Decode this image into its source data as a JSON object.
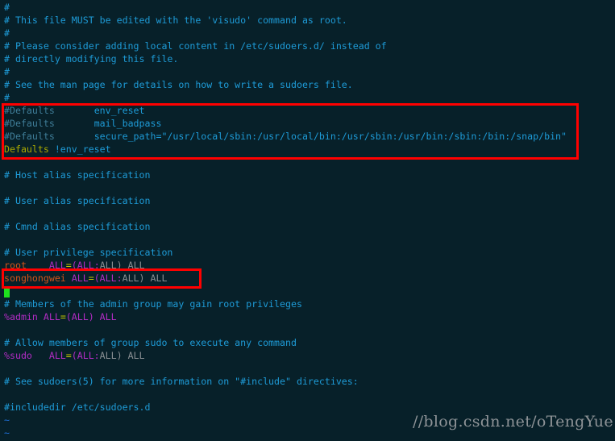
{
  "editor": {
    "colors": {
      "background": "#072029",
      "comment": "#1e9bd7",
      "highlight_box": "#ff0000",
      "cursor": "#1ee01e"
    },
    "lines": [
      [
        {
          "t": "#",
          "c": "comment"
        }
      ],
      [
        {
          "t": "# This file MUST be edited with the 'visudo' command as root.",
          "c": "comment"
        }
      ],
      [
        {
          "t": "#",
          "c": "comment"
        }
      ],
      [
        {
          "t": "# Please consider adding local content in /etc/sudoers.d/ instead of",
          "c": "comment"
        }
      ],
      [
        {
          "t": "# directly modifying this file.",
          "c": "comment"
        }
      ],
      [
        {
          "t": "#",
          "c": "comment"
        }
      ],
      [
        {
          "t": "# See the man page for details on how to write a sudoers file.",
          "c": "comment"
        }
      ],
      [
        {
          "t": "#",
          "c": "comment"
        }
      ],
      [
        {
          "t": "#Defaults       ",
          "c": "dcomment"
        },
        {
          "t": "env_reset",
          "c": "comment"
        }
      ],
      [
        {
          "t": "#Defaults       ",
          "c": "dcomment"
        },
        {
          "t": "mail_badpass",
          "c": "comment"
        }
      ],
      [
        {
          "t": "#Defaults       ",
          "c": "dcomment"
        },
        {
          "t": "secure_path=\"/usr/local/sbin:/usr/local/bin:/usr/sbin:/usr/bin:/sbin:/bin:/snap/bin\"",
          "c": "comment"
        }
      ],
      [
        {
          "t": "Defaults",
          "c": "yellow"
        },
        {
          "t": " !env_reset",
          "c": "comment"
        }
      ],
      [],
      [
        {
          "t": "# Host alias specification",
          "c": "comment"
        }
      ],
      [],
      [
        {
          "t": "# User alias specification",
          "c": "comment"
        }
      ],
      [],
      [
        {
          "t": "# Cmnd alias specification",
          "c": "comment"
        }
      ],
      [],
      [
        {
          "t": "# User privilege specification",
          "c": "comment"
        }
      ],
      [
        {
          "t": "root",
          "c": "user"
        },
        {
          "t": "    ALL",
          "c": "kw"
        },
        {
          "t": "=",
          "c": "eq"
        },
        {
          "t": "(ALL:",
          "c": "kw"
        },
        {
          "t": "ALL) ALL",
          "c": "plain"
        }
      ],
      [
        {
          "t": "songhongwei",
          "c": "user"
        },
        {
          "t": " ALL",
          "c": "kw"
        },
        {
          "t": "=",
          "c": "eq"
        },
        {
          "t": "(ALL:",
          "c": "kw"
        },
        {
          "t": "ALL) ALL",
          "c": "plain"
        }
      ],
      [
        {
          "t": "",
          "c": "cursor"
        }
      ],
      [
        {
          "t": "# Members of the admin group may gain root privileges",
          "c": "comment"
        }
      ],
      [
        {
          "t": "%admin ALL",
          "c": "kw"
        },
        {
          "t": "=",
          "c": "eq"
        },
        {
          "t": "(ALL) ALL",
          "c": "kw"
        }
      ],
      [],
      [
        {
          "t": "# Allow members of group sudo to execute any command",
          "c": "comment"
        }
      ],
      [
        {
          "t": "%sudo   ALL",
          "c": "kw"
        },
        {
          "t": "=",
          "c": "eq"
        },
        {
          "t": "(ALL:",
          "c": "kw"
        },
        {
          "t": "ALL) ALL",
          "c": "plain"
        }
      ],
      [],
      [
        {
          "t": "# See sudoers(5) for more information on \"#include\" directives:",
          "c": "comment"
        }
      ],
      [],
      [
        {
          "t": "#includedir /etc/sudoers.d",
          "c": "comment"
        }
      ],
      [
        {
          "t": "~",
          "c": "tilde"
        }
      ],
      [
        {
          "t": "~",
          "c": "tilde"
        }
      ]
    ]
  },
  "watermark": "//blog.csdn.net/oTengYue"
}
